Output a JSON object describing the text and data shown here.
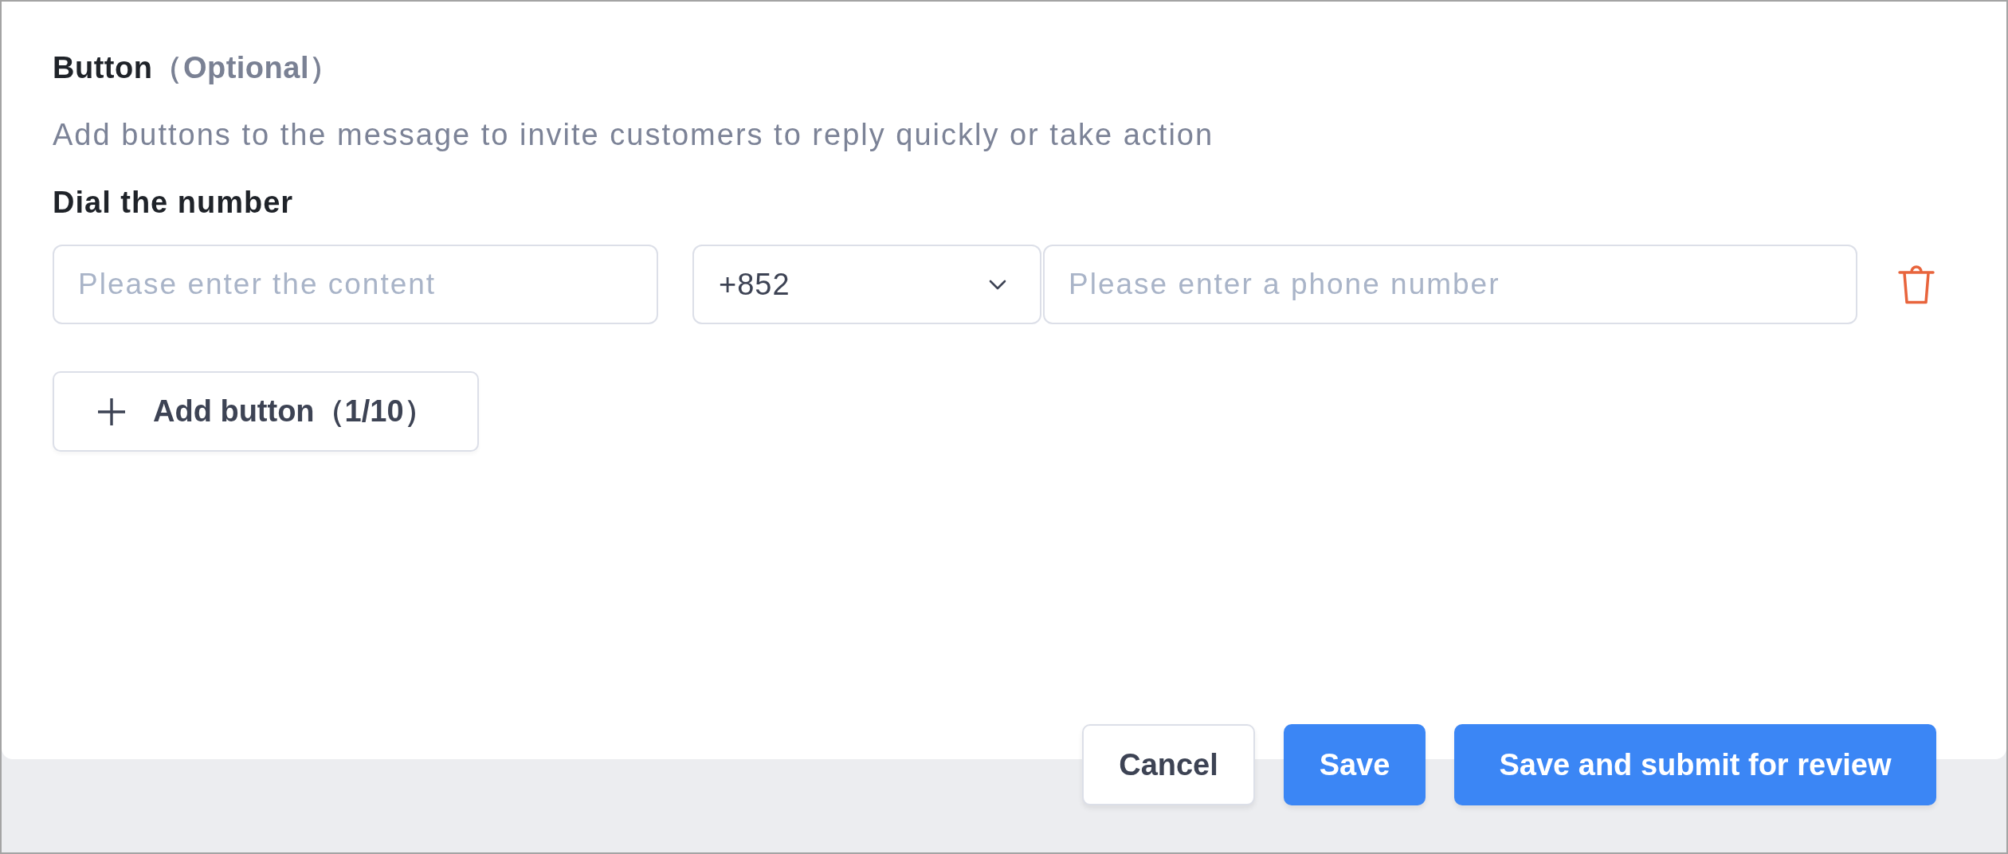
{
  "section": {
    "title": "Button",
    "optional_note": "（Optional）",
    "description": "Add buttons to the message to invite customers to reply quickly or take action"
  },
  "items": [
    {
      "kind": "dial",
      "label": "Dial the number",
      "content": {
        "placeholder": "Please enter the content"
      },
      "country_code": {
        "value": "+852"
      },
      "phone": {
        "placeholder": "Please enter a phone number"
      }
    }
  ],
  "add_button": {
    "label": "Add button（1/10）"
  },
  "footer": [
    {
      "kind": "secondary",
      "label": "Cancel"
    },
    {
      "kind": "primary",
      "label": "Save"
    },
    {
      "kind": "primary",
      "label": "Save and submit for review"
    }
  ]
}
